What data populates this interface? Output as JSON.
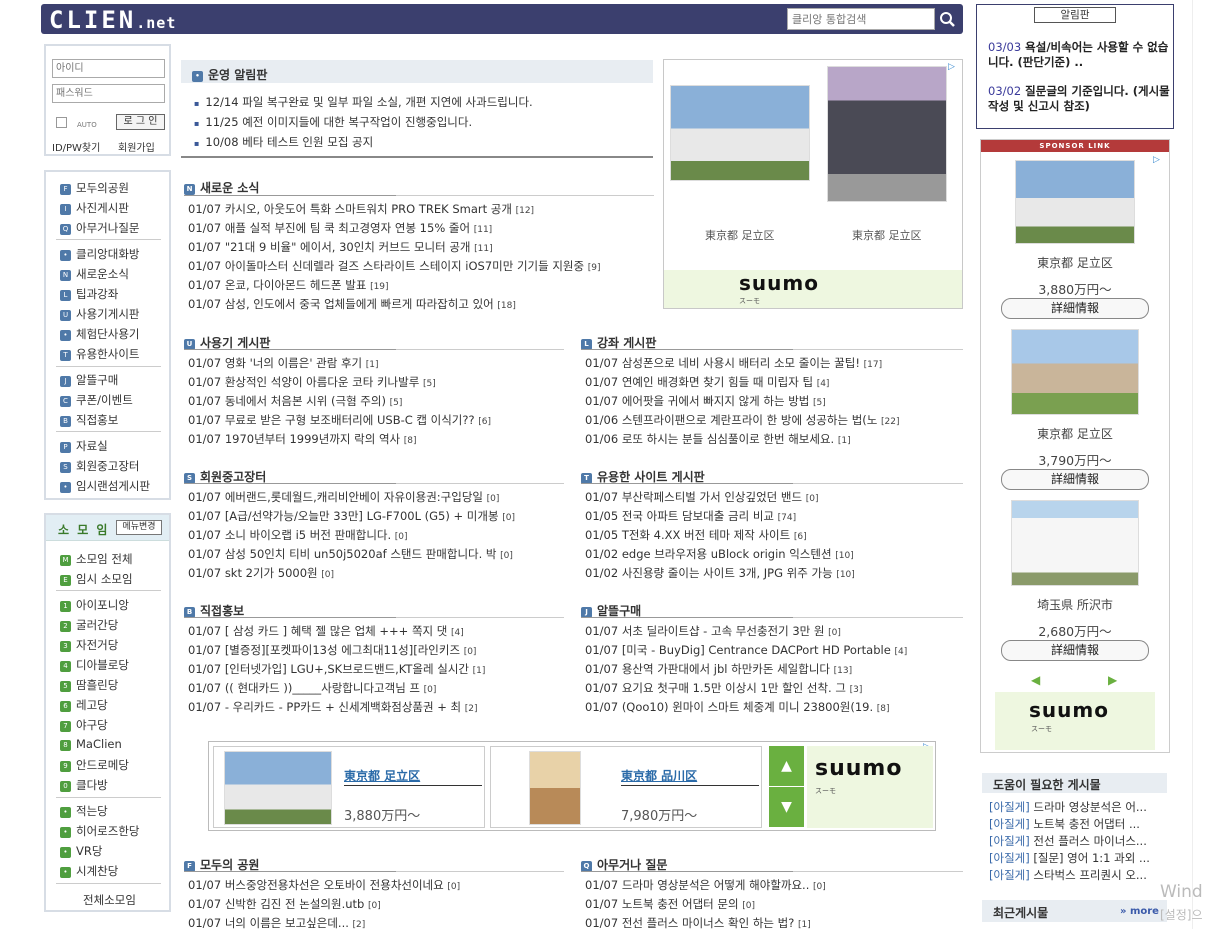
{
  "header": {
    "logo": "CLIEN",
    "logo_suffix": ".net",
    "search_placeholder": "클리앙 통합검색"
  },
  "login": {
    "id_placeholder": "아이디",
    "pw_placeholder": "패스워드",
    "auto_label": "AUTO",
    "login_button": "로 그 인",
    "find_link": "ID/PW찾기",
    "join_link": "회원가입"
  },
  "menu": [
    {
      "icon": "F",
      "label": "모두의공원"
    },
    {
      "icon": "I",
      "label": "사진게시판"
    },
    {
      "icon": "Q",
      "label": "아무거나질문"
    },
    {
      "icon": "•",
      "label": "클리앙대화방"
    },
    {
      "icon": "N",
      "label": "새로운소식"
    },
    {
      "icon": "L",
      "label": "팁과강좌"
    },
    {
      "icon": "U",
      "label": "사용기게시판"
    },
    {
      "icon": "•",
      "label": "체험단사용기"
    },
    {
      "icon": "T",
      "label": "유용한사이트"
    },
    {
      "icon": "J",
      "label": "알뜰구매"
    },
    {
      "icon": "C",
      "label": "쿠폰/이벤트"
    },
    {
      "icon": "B",
      "label": "직접홍보"
    },
    {
      "icon": "P",
      "label": "자료실"
    },
    {
      "icon": "S",
      "label": "회원중고장터"
    },
    {
      "icon": "•",
      "label": "임시랜섬게시판"
    }
  ],
  "somoim": {
    "title": "소 모 임",
    "menu_change": "메뉴변경",
    "items": [
      {
        "icon": "M",
        "label": "소모임 전체"
      },
      {
        "icon": "E",
        "label": "임시 소모임"
      },
      {
        "icon": "1",
        "label": "아이포니앙"
      },
      {
        "icon": "2",
        "label": "굴러간당"
      },
      {
        "icon": "3",
        "label": "자전거당"
      },
      {
        "icon": "4",
        "label": "디아블로당"
      },
      {
        "icon": "5",
        "label": "땀흘린당"
      },
      {
        "icon": "6",
        "label": "레고당"
      },
      {
        "icon": "7",
        "label": "야구당"
      },
      {
        "icon": "8",
        "label": "MaClien"
      },
      {
        "icon": "9",
        "label": "안드로메당"
      },
      {
        "icon": "0",
        "label": "클다방"
      },
      {
        "icon": "•",
        "label": "적는당"
      },
      {
        "icon": "•",
        "label": "히어로즈한당"
      },
      {
        "icon": "•",
        "label": "VR당"
      },
      {
        "icon": "•",
        "label": "시계찬당"
      }
    ],
    "all": "전체소모임"
  },
  "notice": {
    "title": "운영 알림판",
    "items": [
      "12/14 파일 복구완료 및 일부 파일 소실, 개편 지연에 사과드립니다.",
      "11/25 예전 이미지들에 대한 복구작업이 진행중입니다.",
      "10/08 베타 테스트 인원 모집 공지"
    ]
  },
  "sections": {
    "news": {
      "icon": "N",
      "title": "새로운 소식",
      "posts": [
        {
          "date": "01/07",
          "title": "카시오, 아웃도어 특화 스마트워치 PRO TREK Smart 공개",
          "count": "[12]"
        },
        {
          "date": "01/07",
          "title": "애플 실적 부진에 팀 쿡 최고경영자 연봉 15% 줄어",
          "count": "[11]"
        },
        {
          "date": "01/07",
          "title": "\"21대 9 비율\" 에이서, 30인치 커브드 모니터 공개",
          "count": "[11]"
        },
        {
          "date": "01/07",
          "title": "아이돌마스터 신데렐라 걸즈 스타라이트 스테이지 iOS7미만 기기들 지원중",
          "count": "[9]"
        },
        {
          "date": "01/07",
          "title": "온쿄, 다이아몬드 헤드폰 발표",
          "count": "[19]"
        },
        {
          "date": "01/07",
          "title": "삼성, 인도에서 중국 업체들에게 빠르게 따라잡히고 있어",
          "count": "[18]"
        }
      ]
    },
    "review": {
      "icon": "U",
      "title": "사용기 게시판",
      "posts": [
        {
          "date": "01/07",
          "title": "영화 '너의 이름은' 관람 후기",
          "count": "[1]"
        },
        {
          "date": "01/07",
          "title": "환상적인 석양이 아름다운 코타 키나발루",
          "count": "[5]"
        },
        {
          "date": "01/07",
          "title": "동네에서 처음본 시위 (극혐 주의)",
          "count": "[5]"
        },
        {
          "date": "01/07",
          "title": "무료로 받은 구형 보조배터리에 USB-C 캡 이식기??",
          "count": "[6]"
        },
        {
          "date": "01/07",
          "title": "1970년부터 1999년까지 락의 역사",
          "count": "[8]"
        }
      ]
    },
    "tips": {
      "icon": "L",
      "title": "강좌 게시판",
      "posts": [
        {
          "date": "01/07",
          "title": "삼성폰으로 네비 사용시 배터리 소모 줄이는 꿀팁!",
          "count": "[17]"
        },
        {
          "date": "01/07",
          "title": "연예인 배경화면 찾기 힘들 때 미립자 팁",
          "count": "[4]"
        },
        {
          "date": "01/07",
          "title": "에어팟을 귀에서 빠지지 않게 하는 방법",
          "count": "[5]"
        },
        {
          "date": "01/06",
          "title": "스텐프라이팬으로 계란프라이 한 방에 성공하는 법(노",
          "count": "[22]"
        },
        {
          "date": "01/06",
          "title": "로또 하시는 분들 심심풀이로 한번 해보세요.",
          "count": "[1]"
        }
      ]
    },
    "market": {
      "icon": "S",
      "title": "회원중고장터",
      "posts": [
        {
          "date": "01/07",
          "title": "에버랜드,롯데월드,캐리비안베이 자유이용권:구입당일",
          "count": "[0]"
        },
        {
          "date": "01/07",
          "title": "[A급/선약가능/오늘만 33만] LG-F700L (G5) + 미개봉",
          "count": "[0]"
        },
        {
          "date": "01/07",
          "title": "소니 바이오랩 i5 버전 판매합니다.",
          "count": "[0]"
        },
        {
          "date": "01/07",
          "title": "삼성 50인치 티비 un50j5020af 스탠드 판매합니다. 박",
          "count": "[0]"
        },
        {
          "date": "01/07",
          "title": "skt 2기가 5000원",
          "count": "[0]"
        }
      ]
    },
    "useful": {
      "icon": "T",
      "title": "유용한 사이트 게시판",
      "posts": [
        {
          "date": "01/07",
          "title": "부산락페스티벌 가서 인상깊었던 밴드",
          "count": "[0]"
        },
        {
          "date": "01/05",
          "title": "전국 아파트 담보대출 금리 비교",
          "count": "[74]"
        },
        {
          "date": "01/05",
          "title": "T전화 4.XX 버전 테마 제작 사이트",
          "count": "[6]"
        },
        {
          "date": "01/02",
          "title": "edge 브라우저용 uBlock origin 익스텐션",
          "count": "[10]"
        },
        {
          "date": "01/02",
          "title": "사진용량 줄이는 사이트 3개, JPG 위주 가능",
          "count": "[10]"
        }
      ]
    },
    "promo": {
      "icon": "B",
      "title": "직접홍보",
      "posts": [
        {
          "date": "01/07",
          "title": "[ 삼성 카드 ] 혜택 젤 많은 업체 +++ 쪽지 댓",
          "count": "[4]"
        },
        {
          "date": "01/07",
          "title": "[별증정][포켓파이13성 에그최대11성][라인키즈",
          "count": "[0]"
        },
        {
          "date": "01/07",
          "title": "[인터넷가입] LGU+,SK브로드밴드,KT올레 실시간",
          "count": "[1]"
        },
        {
          "date": "01/07",
          "title": "(( 현대카드 ))_____사랑합니다고객님 프",
          "count": "[0]"
        },
        {
          "date": "01/07",
          "title": "- 우리카드 - PP카드 + 신세계백화점상품권 + 최",
          "count": "[2]"
        }
      ]
    },
    "deals": {
      "icon": "J",
      "title": "알뜰구매",
      "posts": [
        {
          "date": "01/07",
          "title": "서초 딜라이트샵 - 고속 무선충전기 3만 원",
          "count": "[0]"
        },
        {
          "date": "01/07",
          "title": "[미국 - BuyDig] Centrance DACPort HD Portable",
          "count": "[4]"
        },
        {
          "date": "01/07",
          "title": "용산역 가판대에서 jbl 하만카돈 세일합니다",
          "count": "[13]"
        },
        {
          "date": "01/07",
          "title": "요기요 첫구매 1.5만 이상시 1만 할인 선착. 그",
          "count": "[3]"
        },
        {
          "date": "01/07",
          "title": "(Qoo10) 윈마이 스마트 체중계 미니 23800원(19.",
          "count": "[8]"
        }
      ]
    },
    "park": {
      "icon": "F",
      "title": "모두의 공원",
      "posts": [
        {
          "date": "01/07",
          "title": "버스중앙전용차선은 오토바이 전용차선이네요",
          "count": "[0]"
        },
        {
          "date": "01/07",
          "title": "신박한 김진 전 논설의원.utb",
          "count": "[0]"
        },
        {
          "date": "01/07",
          "title": "너의 이름은 보고싶은데...",
          "count": "[2]"
        }
      ]
    },
    "qna": {
      "icon": "Q",
      "title": "아무거나 질문",
      "posts": [
        {
          "date": "01/07",
          "title": "드라마 영상분석은 어떻게 해야할까요..",
          "count": "[0]"
        },
        {
          "date": "01/07",
          "title": "노트북 충전 어댑터 문의",
          "count": "[0]"
        },
        {
          "date": "01/07",
          "title": "전선 플러스 마이너스 확인 하는 법?",
          "count": "[1]"
        }
      ]
    }
  },
  "ad_main": {
    "left_caption": "東京都 足立区",
    "right_caption": "東京都 足立区",
    "brand": "suumo",
    "brand_sub": "スーモ"
  },
  "board_notice": {
    "title": "알림판",
    "items": [
      {
        "date": "03/03",
        "text": "욕설/비속어는 사용할 수 없습니다. (판단기준) .."
      },
      {
        "date": "03/02",
        "text": "질문글의 기준입니다. (게시물작성 및 신고시 참조)"
      }
    ]
  },
  "sponsor": {
    "label": "SPONSOR LINK",
    "cards": [
      {
        "place": "東京都 足立区",
        "price": "3,880万円～",
        "button": "詳細情報"
      },
      {
        "place": "東京都 足立区",
        "price": "3,790万円～",
        "button": "詳細情報"
      },
      {
        "place": "埼玉県 所沢市",
        "price": "2,680万円～",
        "button": "詳細情報"
      }
    ],
    "brand": "suumo",
    "brand_sub": "スーモ"
  },
  "ad_bottom": {
    "cards": [
      {
        "location": "東京都 足立区",
        "price": "3,880万円～"
      },
      {
        "location": "東京都 品川区",
        "price": "7,980万円～"
      }
    ],
    "brand": "suumo",
    "brand_sub": "スーモ"
  },
  "help": {
    "title": "도움이 필요한 게시물",
    "items": [
      {
        "tag": "[아질게]",
        "text": "드라마 영상분석은 어..."
      },
      {
        "tag": "[아질게]",
        "text": "노트북 충전 어댑터 ..."
      },
      {
        "tag": "[아질게]",
        "text": "전선 플러스 마이너스..."
      },
      {
        "tag": "[아질게]",
        "text": "[질문] 영어 1:1 과외 ..."
      },
      {
        "tag": "[아질게]",
        "text": "스타벅스 프리퀀시 오..."
      }
    ]
  },
  "recent": {
    "title": "최근게시물",
    "more": "» more"
  },
  "system": {
    "watermark1": "Wind",
    "watermark2": "[설정]으"
  },
  "colors": {
    "header_bg": "#3b3f6e",
    "board_icon": "#4f79a8",
    "somoim_icon": "#4f9e3f",
    "sponsor_head": "#b43a3a",
    "suumo_green": "#6ab040"
  }
}
